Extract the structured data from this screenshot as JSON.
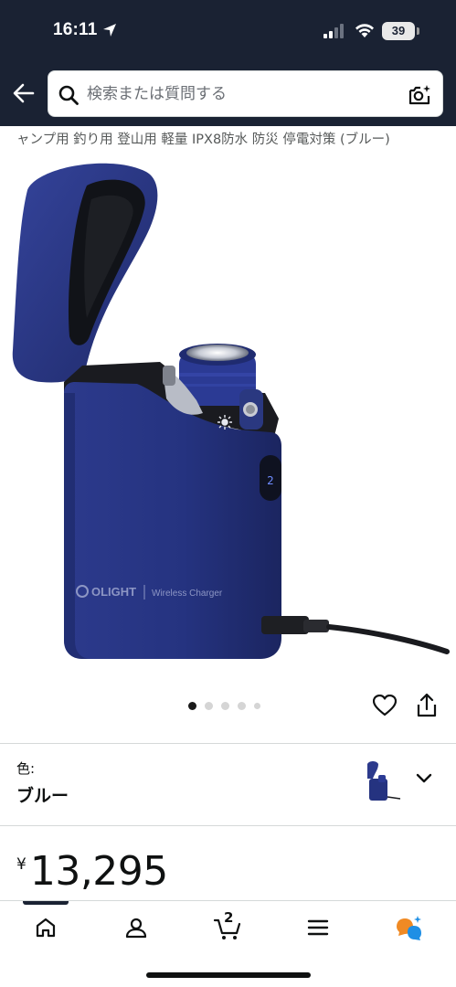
{
  "status_bar": {
    "time": "16:11",
    "battery": "39"
  },
  "search": {
    "placeholder": "検索または質問する"
  },
  "product": {
    "title": "ャンプ用 釣り用 登山用 軽量 IPX8防水 防災 停電対策 (ブルー)",
    "brand_logo": "OLIGHT",
    "device_label": "Wireless Charger",
    "image_count": 5,
    "active_image_index": 0
  },
  "variant": {
    "label": "色:",
    "value": "ブルー"
  },
  "price": {
    "symbol": "¥",
    "value": "13,295"
  },
  "tabbar": {
    "cart_count": "2",
    "items": [
      "home-icon",
      "account-icon",
      "cart-icon",
      "menu-icon",
      "rufus-icon"
    ]
  },
  "colors": {
    "header_bg": "#1a2233",
    "product_blue": "#24307a",
    "text": "#0f1111"
  }
}
